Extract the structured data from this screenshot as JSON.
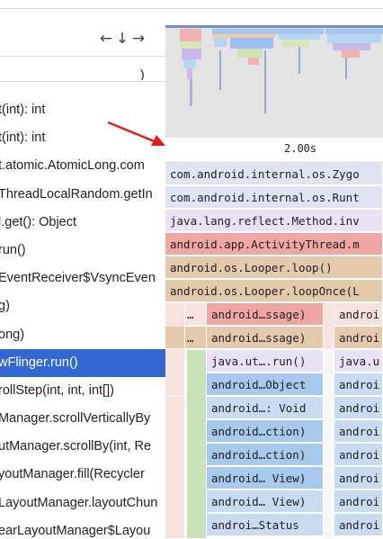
{
  "nav": {
    "back": "←",
    "down": "↓",
    "forward": "→"
  },
  "method_list": {
    "clipped_top": ")",
    "rows": [
      "t(int): int",
      "t(int): int",
      "t.atomic.AtomicLong.com",
      "ThreadLocalRandom.getIn",
      "l.get(): Object",
      "run()",
      "EventReceiver$VsyncEven",
      "g)",
      "ong)",
      "wFlinger.run()",
      "rollStep(int, int, int[])",
      "Manager.scrollVerticallyBy",
      "utManager.scrollBy(int, Re",
      "youtManager.fill(Recycler",
      "LayoutManager.layoutChun",
      "earLayoutManager$Layou"
    ],
    "selected_index": 9
  },
  "timeline": {
    "tick_label": "2.00s"
  },
  "flame": {
    "colors": {
      "blue_light": "#dfe4f2",
      "lavender": "#e9e1f6",
      "red": "#f0a7a3",
      "tan": "#e4c9ad",
      "pink": "#f7e2de",
      "light_blue": "#c8dbf1",
      "blue": "#a8c9ee",
      "green": "#c9e2ba",
      "accent": "#3168d1"
    },
    "rows": [
      "com.android.internal.os.Zygo",
      "com.android.internal.os.Runt",
      "java.lang.reflect.Method.inv",
      "android.app.ActivityThread.m",
      "android.os.Looper.loop()",
      "android.os.Looper.loopOnce(L"
    ],
    "dots_1": "…",
    "dots_2": "…",
    "left_col": [
      "android…ssage)",
      "android…ssage)",
      "java.ut….run()",
      "android…Object",
      "android…: Void",
      "android…ction)",
      "android…ction)",
      "android… View)",
      "android… View)",
      "androi…Status"
    ],
    "right_col": [
      "androi",
      "androi",
      "java.u",
      "androi",
      "androi",
      "androi",
      "androi",
      "androi",
      "androi",
      "androi"
    ]
  }
}
